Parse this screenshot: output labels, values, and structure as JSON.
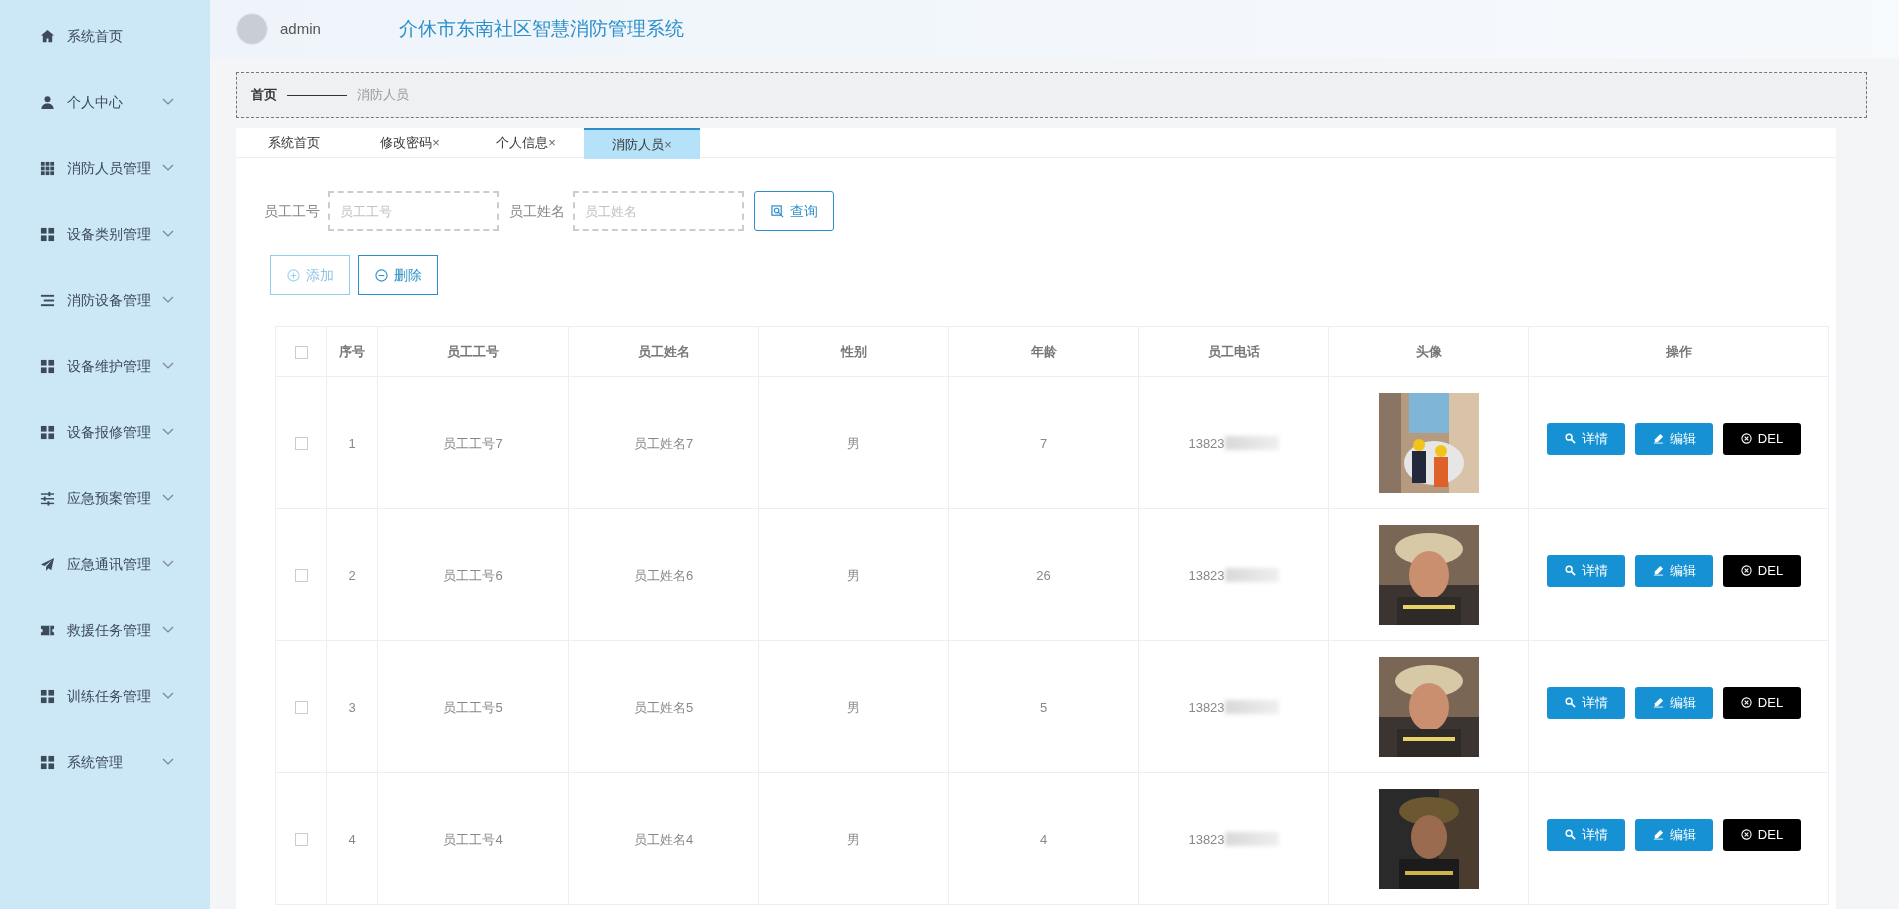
{
  "sidebar": {
    "items": [
      {
        "label": "系统首页",
        "expandable": false
      },
      {
        "label": "个人中心",
        "expandable": true
      },
      {
        "label": "消防人员管理",
        "expandable": true
      },
      {
        "label": "设备类别管理",
        "expandable": true
      },
      {
        "label": "消防设备管理",
        "expandable": true
      },
      {
        "label": "设备维护管理",
        "expandable": true
      },
      {
        "label": "设备报修管理",
        "expandable": true
      },
      {
        "label": "应急预案管理",
        "expandable": true
      },
      {
        "label": "应急通讯管理",
        "expandable": true
      },
      {
        "label": "救援任务管理",
        "expandable": true
      },
      {
        "label": "训练任务管理",
        "expandable": true
      },
      {
        "label": "系统管理",
        "expandable": true
      }
    ]
  },
  "header": {
    "user": "admin",
    "title": "介休市东南社区智慧消防管理系统"
  },
  "breadcrumb": {
    "home": "首页",
    "current": "消防人员"
  },
  "tabs": [
    {
      "label": "系统首页",
      "closable": false,
      "selected": false
    },
    {
      "label": "修改密码",
      "closable": true,
      "selected": false
    },
    {
      "label": "个人信息",
      "closable": true,
      "selected": false
    },
    {
      "label": "消防人员",
      "closable": true,
      "selected": true
    }
  ],
  "close_glyph": "×",
  "search": {
    "fields": [
      {
        "label": "员工工号",
        "placeholder": "员工工号"
      },
      {
        "label": "员工姓名",
        "placeholder": "员工姓名"
      }
    ],
    "button": "查询"
  },
  "actions": [
    {
      "kind": "add",
      "label": "添加"
    },
    {
      "kind": "delete",
      "label": "删除"
    }
  ],
  "table": {
    "columns": [
      "序号",
      "员工工号",
      "员工姓名",
      "性别",
      "年龄",
      "员工电话",
      "头像",
      "操作"
    ],
    "select_all_checked": false,
    "rows": [
      {
        "checked": false,
        "index": "1",
        "id": "员工工号7",
        "name": "员工姓名7",
        "gender": "男",
        "age": "7",
        "phone": "13823",
        "buttons": [
          "详情",
          "编辑",
          "DEL"
        ]
      },
      {
        "checked": false,
        "index": "2",
        "id": "员工工号6",
        "name": "员工姓名6",
        "gender": "男",
        "age": "26",
        "phone": "13823",
        "buttons": [
          "详情",
          "编辑",
          "DEL"
        ]
      },
      {
        "checked": false,
        "index": "3",
        "id": "员工工号5",
        "name": "员工姓名5",
        "gender": "男",
        "age": "5",
        "phone": "13823",
        "buttons": [
          "详情",
          "编辑",
          "DEL"
        ]
      },
      {
        "checked": false,
        "index": "4",
        "id": "员工工号4",
        "name": "员工姓名4",
        "gender": "男",
        "age": "4",
        "phone": "13823",
        "buttons": [
          "详情",
          "编辑",
          "DEL"
        ]
      }
    ]
  }
}
